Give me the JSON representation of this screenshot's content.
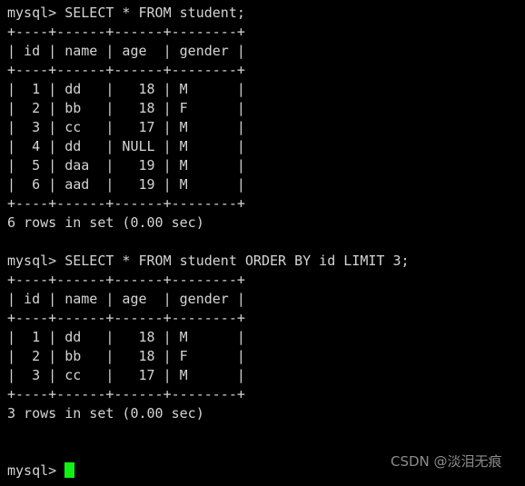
{
  "terminal": {
    "title": "mysql command line client",
    "prompt": "mysql> ",
    "colors": {
      "background": "#000000",
      "foreground": "#d4d4d4",
      "cursor": "#12f212",
      "watermark": "#8c8c8c"
    },
    "cursor": {
      "visible": true,
      "shape": "block",
      "line_index": 24,
      "column": 7
    },
    "lines": [
      "mysql> SELECT * FROM student;",
      "+----+------+------+--------+",
      "| id | name | age  | gender |",
      "+----+------+------+--------+",
      "|  1 | dd   |   18 | M      |",
      "|  2 | bb   |   18 | F      |",
      "|  3 | cc   |   17 | M      |",
      "|  4 | dd   | NULL | M      |",
      "|  5 | daa  |   19 | M      |",
      "|  6 | aad  |   19 | M      |",
      "+----+------+------+--------+",
      "6 rows in set (0.00 sec)",
      "",
      "mysql> SELECT * FROM student ORDER BY id LIMIT 3;",
      "+----+------+------+--------+",
      "| id | name | age  | gender |",
      "+----+------+------+--------+",
      "|  1 | dd   |   18 | M      |",
      "|  2 | bb   |   18 | F      |",
      "|  3 | cc   |   17 | M      |",
      "+----+------+------+--------+",
      "3 rows in set (0.00 sec)",
      "",
      "",
      "mysql> "
    ],
    "queries": [
      {
        "sql": "SELECT * FROM student;",
        "status": "6 rows in set (0.00 sec)",
        "row_count": 6,
        "duration": "0.00 sec",
        "columns": [
          "id",
          "name",
          "age",
          "gender"
        ],
        "rows": [
          [
            "1",
            "dd",
            "18",
            "M"
          ],
          [
            "2",
            "bb",
            "18",
            "F"
          ],
          [
            "3",
            "cc",
            "17",
            "M"
          ],
          [
            "4",
            "dd",
            "NULL",
            "M"
          ],
          [
            "5",
            "daa",
            "19",
            "M"
          ],
          [
            "6",
            "aad",
            "19",
            "M"
          ]
        ]
      },
      {
        "sql": "SELECT * FROM student ORDER BY id LIMIT 3;",
        "status": "3 rows in set (0.00 sec)",
        "row_count": 3,
        "duration": "0.00 sec",
        "columns": [
          "id",
          "name",
          "age",
          "gender"
        ],
        "rows": [
          [
            "1",
            "dd",
            "18",
            "M"
          ],
          [
            "2",
            "bb",
            "18",
            "F"
          ],
          [
            "3",
            "cc",
            "17",
            "M"
          ]
        ]
      }
    ]
  },
  "watermark": {
    "text": "CSDN @淡泪无痕"
  }
}
